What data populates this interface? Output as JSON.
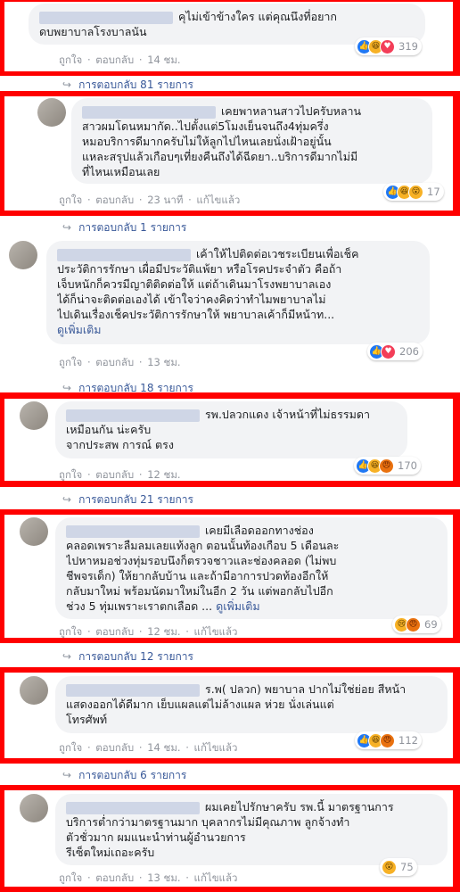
{
  "actions": {
    "like": "ถูกใจ",
    "reply": "ตอบกลับ",
    "sep": "·",
    "edited": "แก้ไขแล้ว",
    "see_more": "ดูเพิ่มเติม"
  },
  "comments": [
    {
      "lines": [
        "คุไม่เข้าข้างใคร แต่คุณนึงที่อยาก",
        "ดบพยาบาลโรงบาลนัน"
      ],
      "time": "14 ชม.",
      "edited": false,
      "reaction_count": "319",
      "reactions": [
        "like",
        "haha",
        "love"
      ]
    },
    {
      "lines": [
        "เคยพาหลานสาวไปครับหลาน",
        "สาวผมโดนหมากัด..ไปตั้งแต่5โมงเย็นจนถึง4ทุ่มครึ่ง",
        "หมอบริการดีมากครับไม่ให้ลูกไปไหนเลยนั่งเฝ้าอยู่นั้น",
        "แหละสรุปแล้วเกือบๆเที่ยงคืนถึงได้ฉีดยา..บริการดีมากไม่มี",
        "ที่ไหนเหมือนเลย"
      ],
      "time": "23 นาที",
      "edited": true,
      "reaction_count": "17",
      "reactions": [
        "like",
        "haha",
        "wow"
      ]
    },
    {
      "lines": [
        "เค้าให้ไปติดต่อเวชระเบียนเพื่อเช็ค",
        "ประวัติการรักษา เผื่อมีประวัติแพ้ยา หรือโรคประจำตัว คือถ้า",
        "เจ็บหนักก็ควรมีญาติติดต่อให้ แต่ถ้าเดินมาโรงพยาบาลเอง",
        "ได้ก็น่าจะติดต่อเองได้ เข้าใจว่าคงคิดว่าทำไมพยาบาลไม่",
        "ไปเดินเรื่องเช็คประวัติการรักษาให้ พยาบาลเค้าก็มีหน้าท..."
      ],
      "see_more": true,
      "time": "13 ชม.",
      "edited": false,
      "reaction_count": "206",
      "reactions": [
        "like",
        "love"
      ]
    },
    {
      "lines": [
        "รพ.ปลวกแดง เจ้าหน้าที่ไม่ธรรมดา",
        "เหมือนกัน น่ะครับ",
        "จากประสพ การณ์ ตรง"
      ],
      "time": "12 ชม.",
      "edited": false,
      "reaction_count": "170",
      "reactions": [
        "like",
        "haha",
        "angry"
      ]
    },
    {
      "lines": [
        "เคยมีเลือดออกทางช่อง",
        "คลอดเพราะลืมลมเลยแท้งลูก ตอนนั้นท้องเกือบ 5 เดือนละ",
        "ไปหาหมอช่วงทุ่มรอบนึงก็ตรวจชาวและช่องคลอด (ไม่พบ",
        "ชีพจรเด็ก) ให้ยากลับบ้าน และถ้ามีอาการปวดท้องอีกให้",
        "กลับมาใหม่ พร้อมนัดมาใหม่ในอีก 2 วัน แต่พอกลับไปอีก",
        "ช่วง 5 ทุ่มเพราะเราตกเลือด ..."
      ],
      "see_more": true,
      "time": "12 ชม.",
      "edited": true,
      "reaction_count": "69",
      "reactions": [
        "sad",
        "angry"
      ]
    },
    {
      "lines": [
        "ร.พ( ปลวก) พยาบาล ปากไม่ใช่ย่อย สีหน้า",
        "แสดงออกได้ดีมาก เย็บแผลแต่ไม่ล้างแผล ห่วย นั่งเล่นแต่",
        "โทรศัพท์"
      ],
      "time": "14 ชม.",
      "edited": true,
      "reaction_count": "112",
      "reactions": [
        "like",
        "haha",
        "angry"
      ]
    },
    {
      "lines": [
        "ผมเคยไปรักษาครับ รพ.นี้ มาตรฐานการ",
        "บริการต่ำกว่ามาตรฐานมาก บุคลากรไม่มีคุณภาพ ลูกจ้างทำ",
        "ตัวชั่วมาก ผมแนะนำท่านผู้อำนวยการ",
        "รีเซ็ตใหม่เถอะครับ"
      ],
      "time": "13 ชม.",
      "edited": true,
      "reaction_count": "75",
      "reactions": [
        "wow"
      ]
    }
  ],
  "reply_links": [
    {
      "label": "การตอบกลับ 81 รายการ"
    },
    {
      "label": "การตอบกลับ 1 รายการ"
    },
    {
      "label": "การตอบกลับ 18 รายการ"
    },
    {
      "label": "การตอบกลับ 21 รายการ"
    },
    {
      "label": "การตอบกลับ 12 รายการ"
    },
    {
      "label": "การตอบกลับ 6 รายการ"
    }
  ],
  "reaction_icons": {
    "like": "👍",
    "haha": "😆",
    "love": "♥",
    "wow": "😮",
    "sad": "😢",
    "angry": "😠"
  }
}
